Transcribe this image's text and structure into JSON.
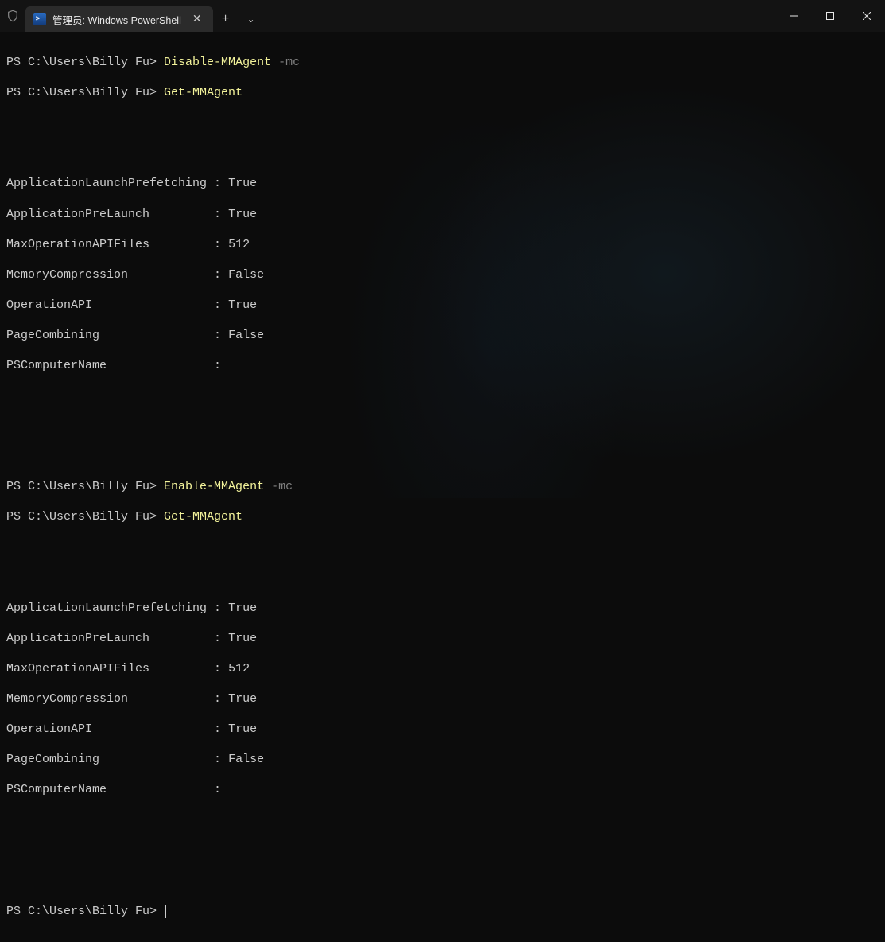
{
  "titlebar": {
    "tab_title": "管理员: Windows PowerShell",
    "ps_icon_text": ">_",
    "close_glyph": "✕",
    "newtab_glyph": "+",
    "dropdown_glyph": "⌄"
  },
  "window_controls": {
    "minimize": "—",
    "maximize": "▢",
    "close": "✕"
  },
  "terminal": {
    "prompt": "PS C:\\Users\\Billy Fu>",
    "lines": {
      "l1_cmd": "Disable-MMAgent",
      "l1_arg": "-mc",
      "l2_cmd": "Get-MMAgent",
      "l3_cmd": "Enable-MMAgent",
      "l3_arg": "-mc",
      "l4_cmd": "Get-MMAgent"
    },
    "block1": {
      "k0": "ApplicationLaunchPrefetching",
      "v0": "True",
      "k1": "ApplicationPreLaunch",
      "v1": "True",
      "k2": "MaxOperationAPIFiles",
      "v2": "512",
      "k3": "MemoryCompression",
      "v3": "False",
      "k4": "OperationAPI",
      "v4": "True",
      "k5": "PageCombining",
      "v5": "False",
      "k6": "PSComputerName",
      "v6": ""
    },
    "block2": {
      "k0": "ApplicationLaunchPrefetching",
      "v0": "True",
      "k1": "ApplicationPreLaunch",
      "v1": "True",
      "k2": "MaxOperationAPIFiles",
      "v2": "512",
      "k3": "MemoryCompression",
      "v3": "True",
      "k4": "OperationAPI",
      "v4": "True",
      "k5": "PageCombining",
      "v5": "False",
      "k6": "PSComputerName",
      "v6": ""
    },
    "colon": " : "
  }
}
